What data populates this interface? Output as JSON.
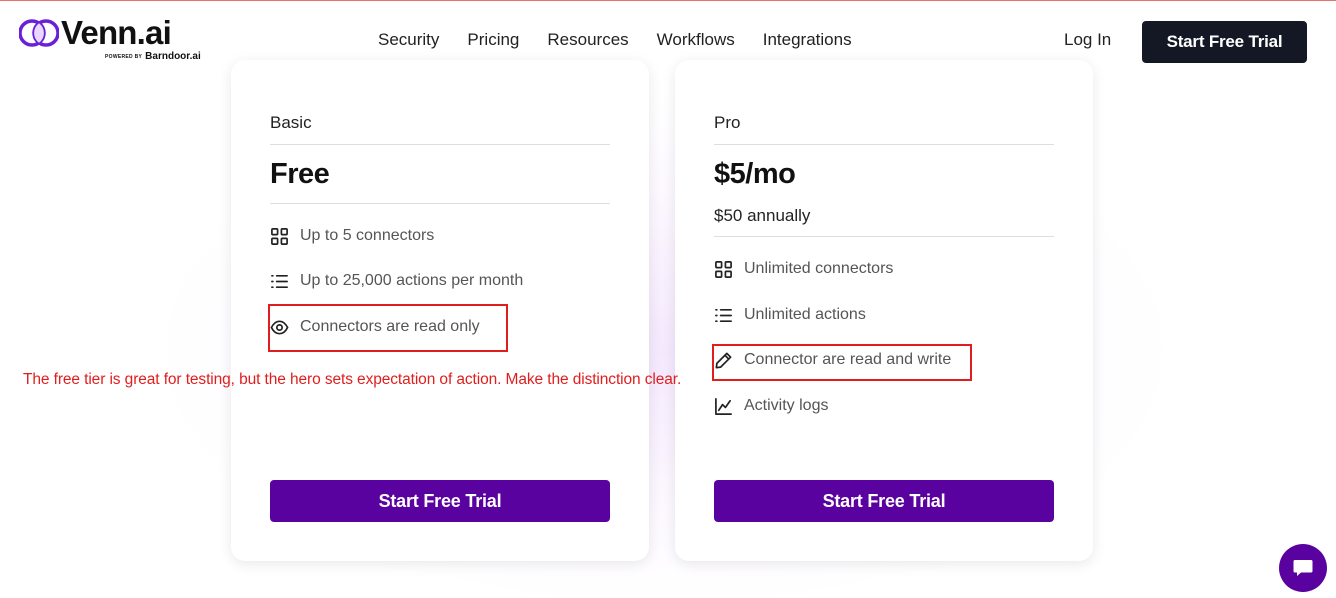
{
  "header": {
    "logo": {
      "name": "Venn.ai",
      "powered_by": "POWERED BY",
      "brand": "Barndoor.ai"
    },
    "nav": [
      "Security",
      "Pricing",
      "Resources",
      "Workflows",
      "Integrations"
    ],
    "login": "Log In",
    "cta": "Start Free Trial"
  },
  "plans": [
    {
      "tier": "Basic",
      "price": "Free",
      "features": [
        {
          "icon": "grid-icon",
          "label": "Up to 5 connectors"
        },
        {
          "icon": "list-icon",
          "label": "Up to 25,000 actions per month"
        },
        {
          "icon": "eye-icon",
          "label": "Connectors are read only"
        }
      ],
      "cta": "Start Free Trial"
    },
    {
      "tier": "Pro",
      "price": "$5/mo",
      "annual": "$50 annually",
      "features": [
        {
          "icon": "grid-icon",
          "label": "Unlimited connectors"
        },
        {
          "icon": "list-icon",
          "label": "Unlimited actions"
        },
        {
          "icon": "pencil-icon",
          "label": "Connector are read and write"
        },
        {
          "icon": "chart-line-icon",
          "label": "Activity logs"
        }
      ],
      "cta": "Start Free Trial"
    }
  ],
  "annotation": "The free tier is great for testing, but the hero sets expectation of action. Make the distinction clear.",
  "chat": {
    "icon": "chat-bubble-icon"
  },
  "colors": {
    "accent": "#5a029f",
    "header_button": "#141824",
    "annotation": "#e01e1e",
    "logo_purple": "#7b2ff7"
  }
}
